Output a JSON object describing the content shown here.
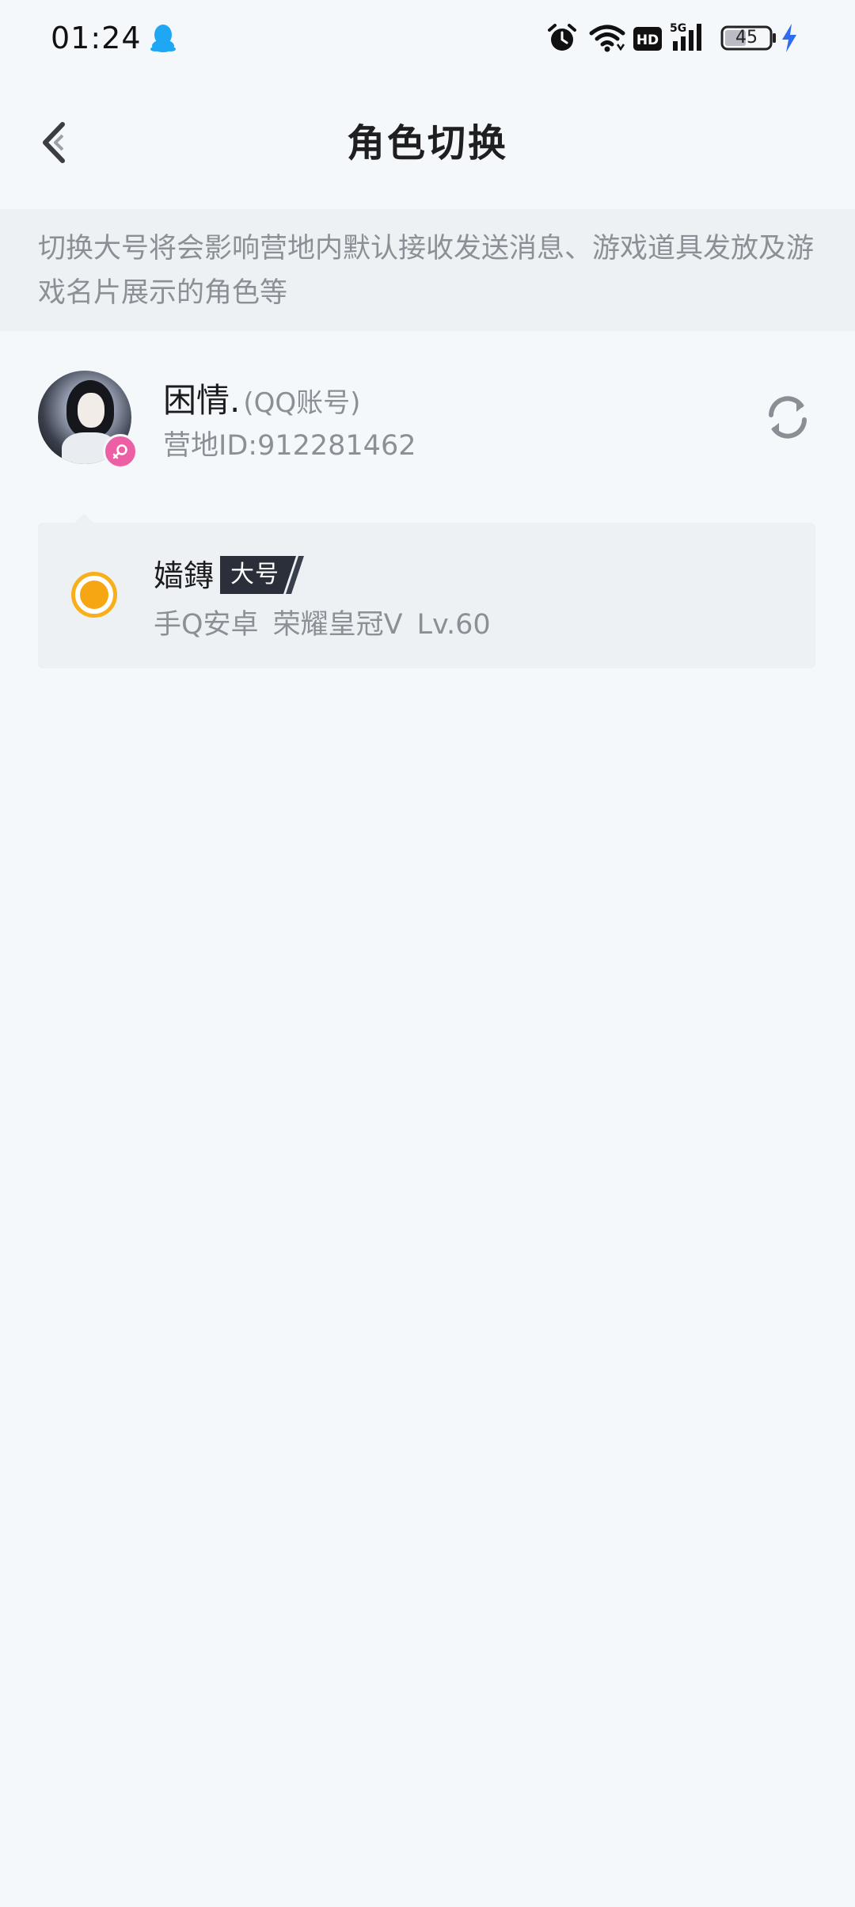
{
  "status_bar": {
    "time": "01:24",
    "battery_level": "45",
    "icons": [
      "qq-icon",
      "alarm-icon",
      "wifi-icon",
      "hd-icon",
      "signal-5g-icon",
      "battery-icon",
      "charging-icon"
    ]
  },
  "header": {
    "title": "角色切换",
    "back_icon": "chevron-left-icon"
  },
  "notice": {
    "text": "切换大号将会影响营地内默认接收发送消息、游戏道具发放及游戏名片展示的角色等"
  },
  "account": {
    "name": "困情.",
    "type": "(QQ账号)",
    "camp_id": "营地ID:912281462",
    "gender_icon": "female-icon",
    "refresh_icon": "refresh-icon"
  },
  "role": {
    "name": "嫱鏄",
    "tag": "大号",
    "platform": "手Q安卓",
    "rank": "荣耀皇冠V",
    "level": "Lv.60",
    "selected": true
  },
  "colors": {
    "background": "#f5f8fb",
    "notice_background": "#eef1f4",
    "secondary_text": "#8c9096",
    "radio_accent": "#f7a613",
    "tag_background": "#2b2f3a",
    "gender_badge": "#ec5fa4"
  }
}
